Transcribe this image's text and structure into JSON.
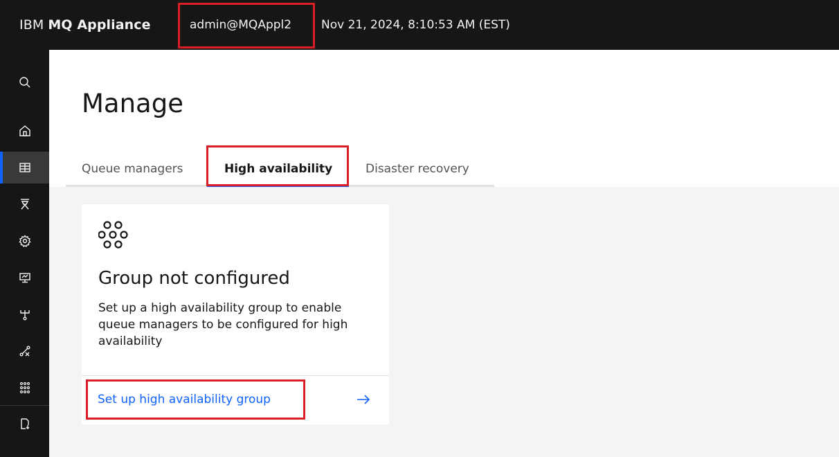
{
  "header": {
    "brand_prefix": "IBM",
    "brand_name": "MQ Appliance",
    "user": "admin@MQAppl2",
    "datetime": "Nov 21, 2024, 8:10:53 AM (EST)"
  },
  "sidebar": {
    "items": [
      {
        "icon": "search-icon"
      },
      {
        "icon": "home-icon"
      },
      {
        "icon": "table-icon",
        "active": true
      },
      {
        "icon": "gateway-icon"
      },
      {
        "icon": "settings-icon"
      },
      {
        "icon": "monitor-icon"
      },
      {
        "icon": "network-icon"
      },
      {
        "icon": "tools-icon"
      },
      {
        "icon": "group-icon"
      },
      {
        "icon": "document-download-icon"
      }
    ]
  },
  "page": {
    "title": "Manage",
    "tabs": [
      {
        "label": "Queue managers",
        "selected": false
      },
      {
        "label": "High availability",
        "selected": true
      },
      {
        "label": "Disaster recovery",
        "selected": false
      }
    ]
  },
  "card": {
    "icon": "group-nodes-icon",
    "title": "Group not configured",
    "description": "Set up a high availability group to enable queue managers to be configured for high availability",
    "link_label": "Set up high availability group",
    "link_icon": "arrow-right-icon"
  },
  "colors": {
    "header_bg": "#161616",
    "accent": "#0f62fe",
    "highlight": "#da1e28",
    "background": "#f4f4f4"
  }
}
